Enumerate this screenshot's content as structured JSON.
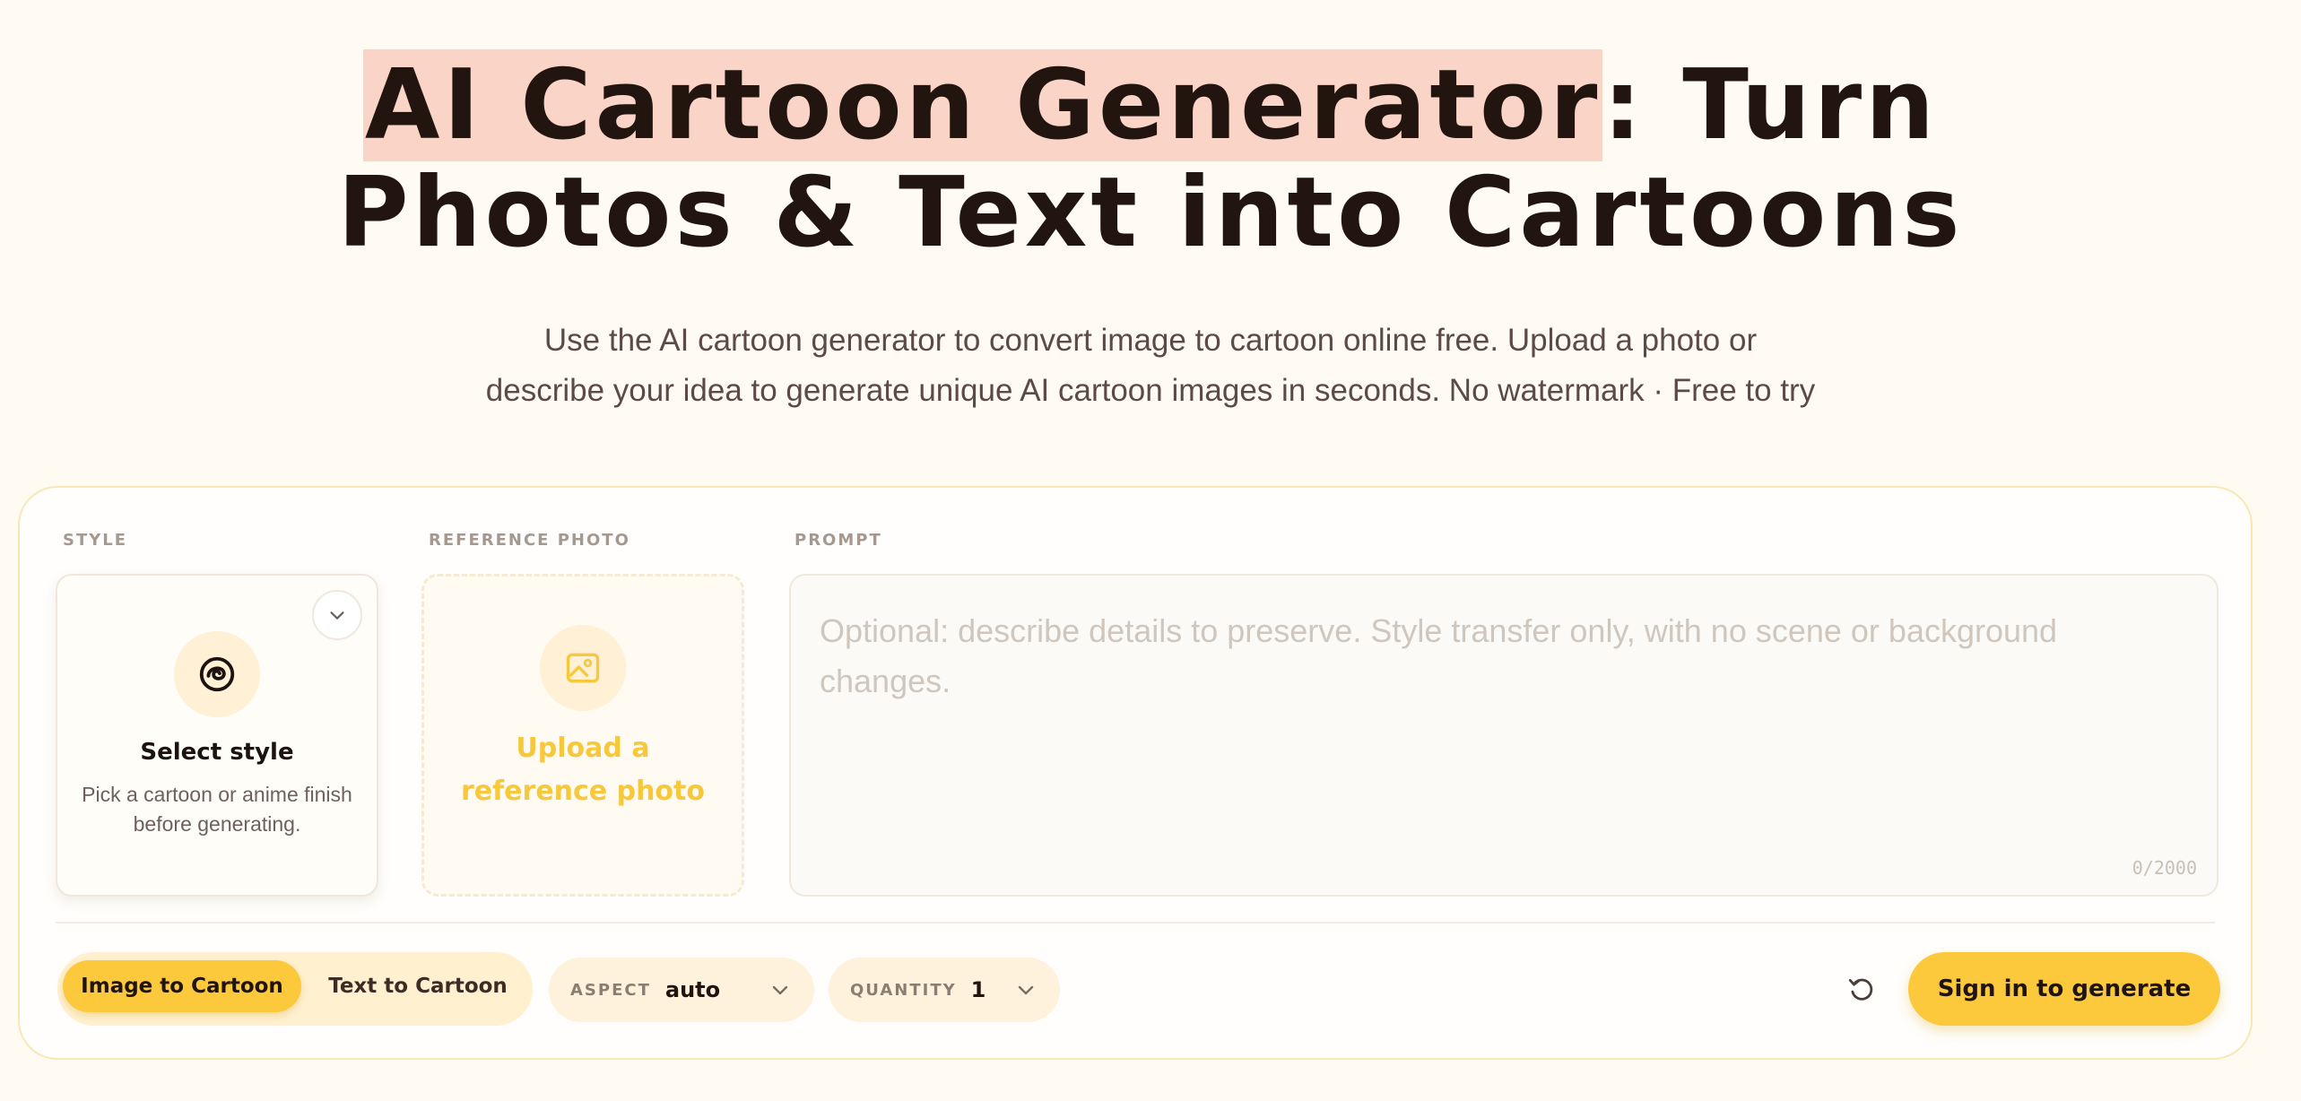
{
  "hero": {
    "title_highlight": "AI Cartoon Generator",
    "title_rest_line1": ": Turn",
    "title_line2": "Photos & Text into Cartoons",
    "subtitle_line1": "Use the AI cartoon generator to convert image to cartoon online free. Upload a photo or",
    "subtitle_line2": "describe your idea to generate unique AI cartoon images in seconds. No watermark · Free to try"
  },
  "panel": {
    "style_label": "STYLE",
    "reference_label": "REFERENCE PHOTO",
    "prompt_label": "PROMPT",
    "style_card": {
      "title": "Select style",
      "description": "Pick a cartoon or anime finish before generating.",
      "icon": "swirl-icon",
      "dropdown_icon": "chevron-down-icon"
    },
    "upload_card": {
      "text": "Upload a reference photo",
      "icon": "image-icon"
    },
    "prompt": {
      "value": "",
      "placeholder": "Optional: describe details to preserve. Style transfer only, with no scene or background changes.",
      "counter": "0/2000"
    }
  },
  "toolbar": {
    "modes": [
      "Image to Cartoon",
      "Text to Cartoon"
    ],
    "active_mode": "Image to Cartoon",
    "aspect_label": "ASPECT",
    "aspect_value": "auto",
    "quantity_label": "QUANTITY",
    "quantity_value": "1",
    "reset_icon": "reset-icon",
    "generate_label": "Sign in to generate"
  },
  "colors": {
    "background": "#fffbf3",
    "accent": "#fcc93d",
    "title_highlight": "#fad4c6",
    "upload_text": "#f8c83c"
  }
}
